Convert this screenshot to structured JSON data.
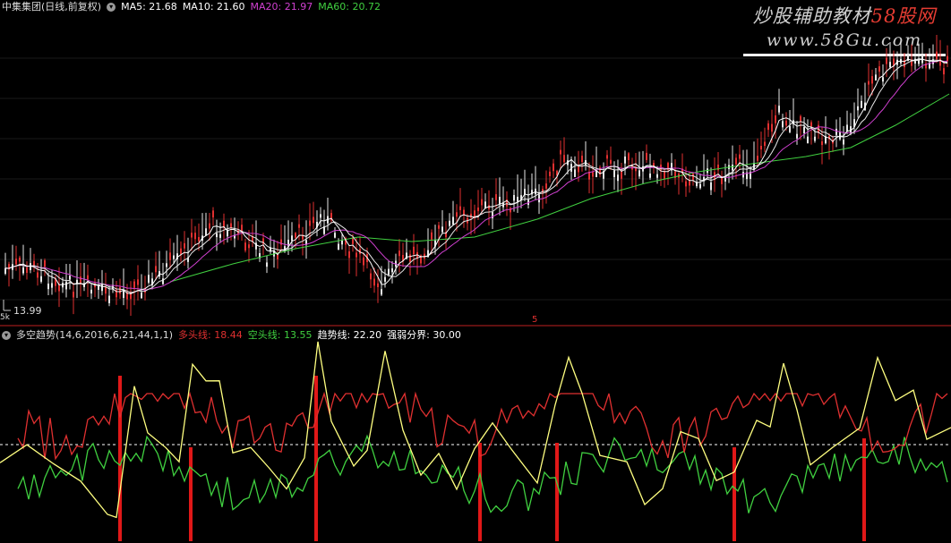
{
  "top_panel": {
    "title": "中集集团(日线,前复权)",
    "ma5": {
      "label": "MA5: 21.68",
      "color": "#ffffff"
    },
    "ma10": {
      "label": "MA10: 21.60",
      "color": "#ffffff"
    },
    "ma20": {
      "label": "MA20: 21.97",
      "color": "#d040d0"
    },
    "ma60": {
      "label": "MA60: 20.72",
      "color": "#40d040"
    },
    "low_price_label": "13.99",
    "period_marker": "5"
  },
  "bottom_panel": {
    "indicator": "多空趋势(14,6,2016,6,21,44,1,1)",
    "bull_line": {
      "label": "多头线: 18.44",
      "color": "#e03030"
    },
    "bear_line": {
      "label": "空头线: 13.55",
      "color": "#40d040"
    },
    "trend_line": {
      "label": "趋势线: 22.20",
      "color": "#ffff80"
    },
    "strength": {
      "label": "强弱分界: 30.00",
      "color": "#ffffff"
    }
  },
  "watermark": {
    "line1a": "炒股辅助教材",
    "line1b": "58股网",
    "line2": "www.58Gu.com"
  },
  "icons": {
    "collapse": "chevron-down-icon"
  }
}
